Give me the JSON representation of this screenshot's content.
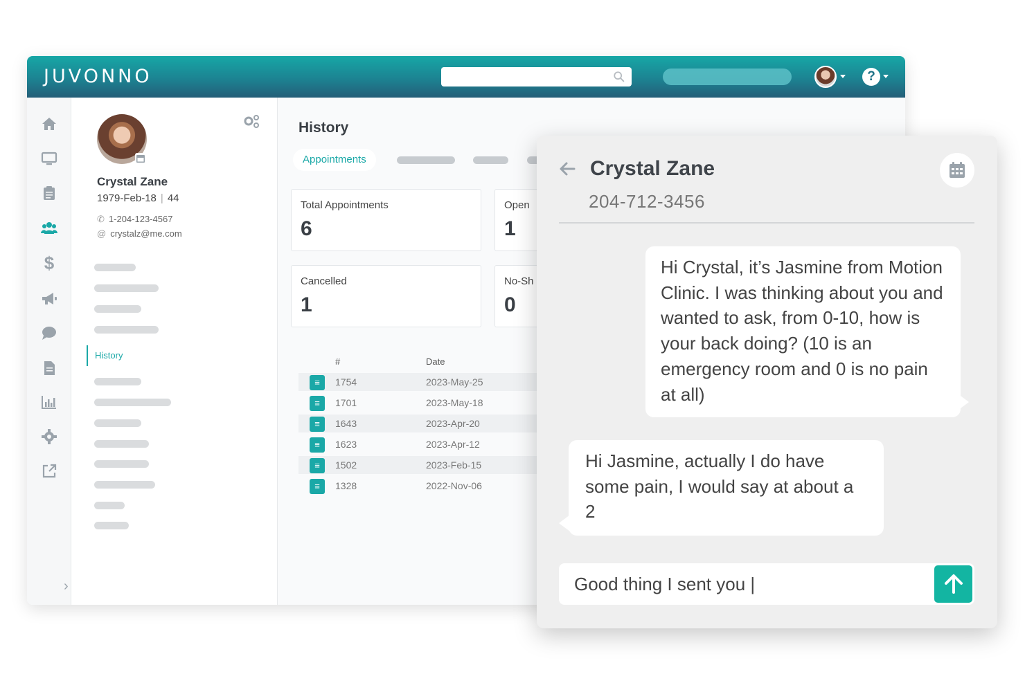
{
  "app": {
    "logo": "JUVONNO"
  },
  "topbar": {
    "search": {
      "value": "",
      "placeholder": ""
    }
  },
  "patient": {
    "name": "Crystal Zane",
    "dob": "1979-Feb-18",
    "age": "44",
    "phone": "1-204-123-4567",
    "email": "crystalz@me.com",
    "menu_active": "History"
  },
  "history": {
    "title": "History",
    "tab_active": "Appointments",
    "cards": [
      {
        "label": "Total Appointments",
        "value": "6"
      },
      {
        "label": "Open",
        "value": "1"
      },
      {
        "label": "Cancelled",
        "value": "1"
      },
      {
        "label": "No-Sh",
        "value": "0"
      }
    ],
    "table": {
      "columns": [
        "#",
        "Date"
      ],
      "rows": [
        {
          "num": "1754",
          "date": "2023-May-25"
        },
        {
          "num": "1701",
          "date": "2023-May-18"
        },
        {
          "num": "1643",
          "date": "2023-Apr-20"
        },
        {
          "num": "1623",
          "date": "2023-Apr-12"
        },
        {
          "num": "1502",
          "date": "2023-Feb-15"
        },
        {
          "num": "1328",
          "date": "2022-Nov-06"
        }
      ]
    }
  },
  "chat": {
    "name": "Crystal Zane",
    "phone": "204-712-3456",
    "messages": [
      {
        "direction": "outgoing",
        "text": "Hi Crystal, it’s Jasmine from Motion Clinic. I was thinking about you and wanted to ask, from 0-10, how is your back doing? (10 is an emergency room and 0 is no pain at all)"
      },
      {
        "direction": "incoming",
        "text": "Hi Jasmine, actually I do have some pain, I would say at about a 2"
      }
    ],
    "composer_value": "Good thing I sent you |"
  },
  "colors": {
    "accent": "#1aa8a7",
    "header_top": "#17a7a6",
    "header_bottom": "#245e78",
    "send": "#13b5a2"
  }
}
